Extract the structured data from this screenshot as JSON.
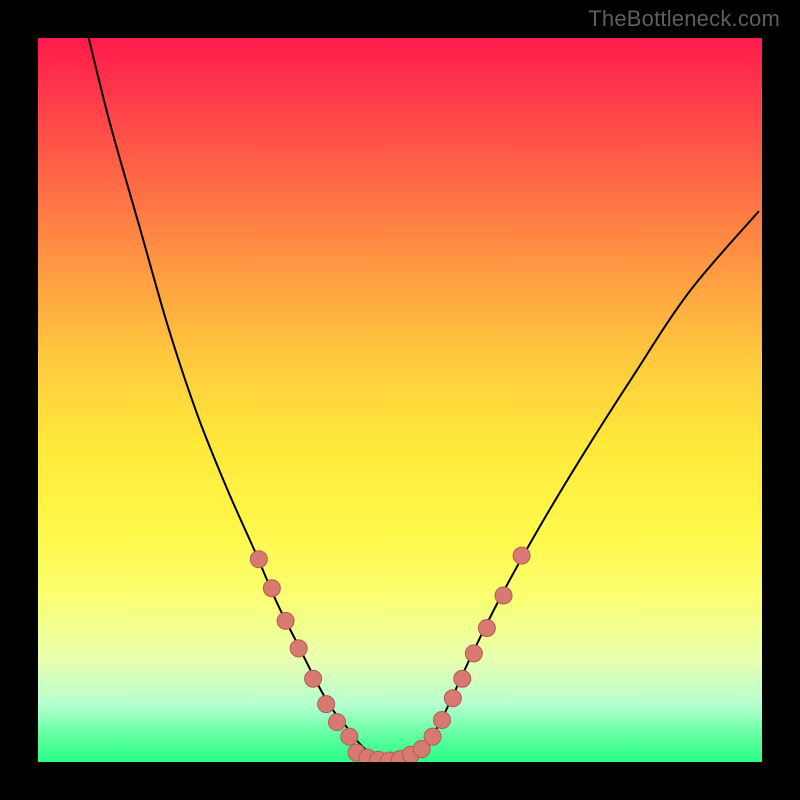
{
  "watermark": "TheBottleneck.com",
  "colors": {
    "frame": "#000000",
    "curve": "#000000",
    "dot_fill": "#d97a72",
    "dot_stroke": "#b45b52"
  },
  "chart_data": {
    "type": "line",
    "title": "",
    "xlabel": "",
    "ylabel": "",
    "xlim": [
      0,
      100
    ],
    "ylim": [
      0,
      100
    ],
    "note": "Axes are unlabeled in the source image; values below are estimated positions in percent of plot width/height (origin top-left as displayed, where 0 = top, 100 = bottom of the gradient).",
    "series": [
      {
        "name": "curve",
        "kind": "line",
        "x": [
          7,
          10,
          14,
          18,
          22,
          26,
          30,
          33,
          36,
          38.5,
          40.5,
          42.5,
          44,
          45.5,
          47,
          49,
          51,
          53,
          55,
          57,
          60,
          64,
          69,
          75,
          82,
          90,
          99.5
        ],
        "y": [
          0,
          12,
          26,
          40,
          52,
          62,
          71,
          78,
          84,
          89,
          92.5,
          95,
          97,
          98.5,
          99.5,
          99.8,
          99.5,
          98.2,
          95.5,
          91.5,
          85,
          77,
          68,
          58,
          47,
          35,
          24
        ]
      },
      {
        "name": "dots-left",
        "kind": "scatter",
        "x": [
          30.5,
          32.3,
          34.2,
          36.0,
          38.0,
          39.8,
          41.3,
          43.0
        ],
        "y": [
          72.0,
          76.0,
          80.5,
          84.3,
          88.5,
          92.0,
          94.5,
          96.5
        ]
      },
      {
        "name": "dots-bottom",
        "kind": "scatter",
        "x": [
          44.0,
          45.5,
          47.0,
          48.5,
          50.0,
          51.5,
          53.0
        ],
        "y": [
          98.7,
          99.4,
          99.7,
          99.8,
          99.6,
          99.0,
          98.2
        ]
      },
      {
        "name": "dots-right",
        "kind": "scatter",
        "x": [
          54.5,
          55.8,
          57.3,
          58.6,
          60.2,
          62.0,
          64.3,
          66.8
        ],
        "y": [
          96.5,
          94.2,
          91.2,
          88.5,
          85.0,
          81.5,
          77.0,
          71.5
        ]
      }
    ]
  }
}
